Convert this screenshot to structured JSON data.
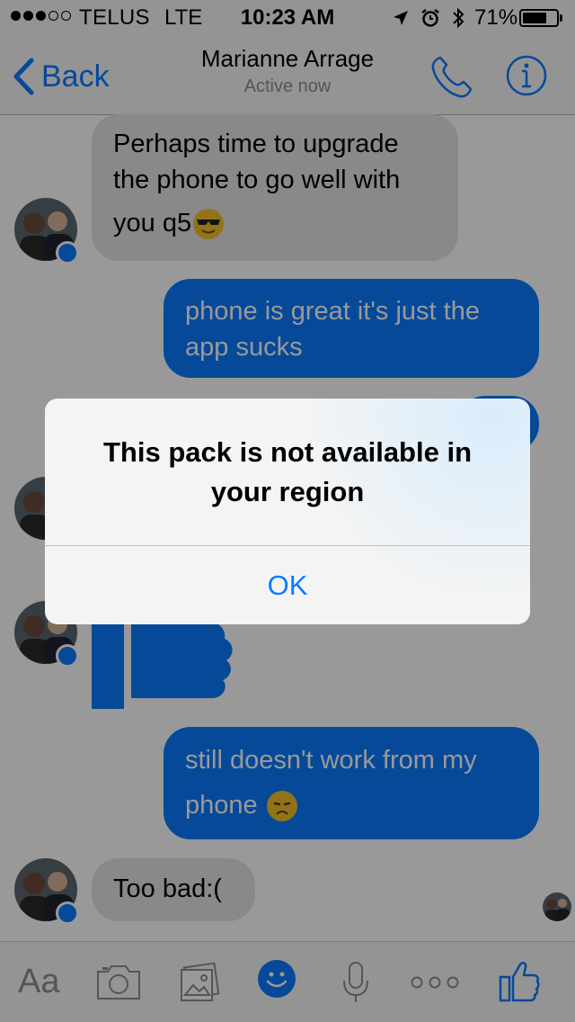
{
  "status_bar": {
    "carrier": "TELUS",
    "network": "LTE",
    "time": "10:23 AM",
    "battery_percent": "71%",
    "battery_level": 0.71,
    "icons": [
      "location-arrow-icon",
      "alarm-icon",
      "bluetooth-icon"
    ]
  },
  "nav": {
    "back_label": "Back",
    "title": "Marianne Arrage",
    "subtitle": "Active now",
    "call_icon": "phone-icon",
    "info_icon": "info-icon"
  },
  "messages": [
    {
      "direction": "incoming",
      "lines": [
        "Perhaps time to upgrade",
        "the phone to go well with"
      ],
      "tail_text": "you q5",
      "emoji": "sunglasses-emoji"
    },
    {
      "direction": "outgoing",
      "lines": [
        "phone is great it's just the",
        "app sucks"
      ]
    },
    {
      "direction": "incoming",
      "type": "sticker",
      "sticker": "thumbs-up-sticker"
    },
    {
      "direction": "outgoing",
      "lines": [
        "still doesn't work from my"
      ],
      "tail_text": "phone",
      "emoji": "disappointed-emoji"
    },
    {
      "direction": "incoming",
      "text": "Too bad:("
    }
  ],
  "input_bar": {
    "text_label": "Aa",
    "icons": [
      "camera-icon",
      "photo-icon",
      "emoji-icon",
      "microphone-icon",
      "more-icon",
      "like-icon"
    ]
  },
  "alert": {
    "title_line1": "This pack is not available in",
    "title_line2": "your region",
    "button": "OK"
  },
  "colors": {
    "accent": "#0a7aff",
    "incoming_bubble": "#e5e5ea",
    "bar_background": "#f7f7f7"
  }
}
